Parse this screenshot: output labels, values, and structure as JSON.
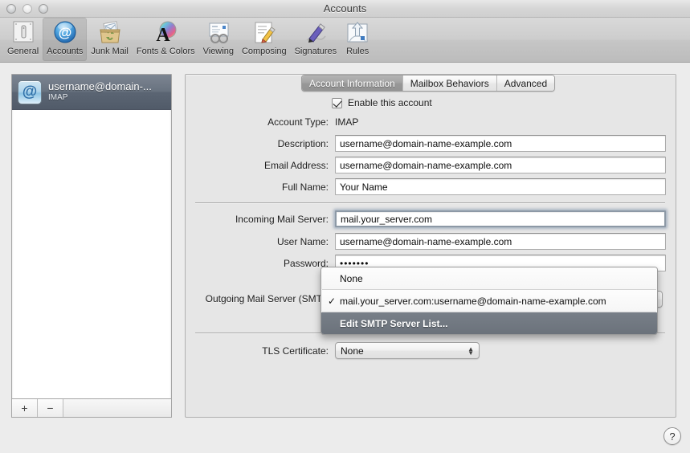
{
  "window": {
    "title": "Accounts",
    "traffic_lights": [
      "close",
      "minimize",
      "zoom"
    ]
  },
  "toolbar": {
    "items": [
      {
        "label": "General",
        "icon": "general-icon",
        "selected": false
      },
      {
        "label": "Accounts",
        "icon": "accounts-at-icon",
        "selected": true
      },
      {
        "label": "Junk Mail",
        "icon": "junk-mail-icon",
        "selected": false
      },
      {
        "label": "Fonts & Colors",
        "icon": "fonts-colors-icon",
        "selected": false
      },
      {
        "label": "Viewing",
        "icon": "viewing-icon",
        "selected": false
      },
      {
        "label": "Composing",
        "icon": "composing-icon",
        "selected": false
      },
      {
        "label": "Signatures",
        "icon": "signatures-icon",
        "selected": false
      },
      {
        "label": "Rules",
        "icon": "rules-icon",
        "selected": false
      }
    ]
  },
  "sidebar": {
    "accounts": [
      {
        "name": "username@domain-...",
        "protocol": "IMAP",
        "icon": "at-account-icon",
        "selected": true
      }
    ],
    "add_label": "+",
    "remove_label": "−"
  },
  "tabs": [
    {
      "label": "Account Information",
      "active": true
    },
    {
      "label": "Mailbox Behaviors",
      "active": false
    },
    {
      "label": "Advanced",
      "active": false
    }
  ],
  "form": {
    "enable_account_label": "Enable this account",
    "enable_account_checked": true,
    "account_type_label": "Account Type:",
    "account_type_value": "IMAP",
    "description_label": "Description:",
    "description_value": "username@domain-name-example.com",
    "email_label": "Email Address:",
    "email_value": "username@domain-name-example.com",
    "full_name_label": "Full Name:",
    "full_name_value": "Your Name",
    "incoming_label": "Incoming Mail Server:",
    "incoming_value": "mail.your_server.com",
    "user_name_label": "User Name:",
    "user_name_value": "username@domain-name-example.com",
    "password_label": "Password:",
    "password_value": "•••••••",
    "smtp_label": "Outgoing Mail Server (SMTP",
    "tls_label": "TLS Certificate:",
    "tls_value": "None",
    "tls_arrows": "▲▼"
  },
  "dropdown": {
    "items": [
      {
        "label": "None",
        "checked": false,
        "highlighted": false
      },
      {
        "label": "mail.your_server.com:username@domain-name-example.com",
        "checked": true,
        "highlighted": false
      },
      {
        "label": "Edit SMTP Server List...",
        "checked": false,
        "highlighted": true
      }
    ],
    "check_glyph": "✓"
  },
  "help": {
    "label": "?"
  },
  "colors": {
    "window_bg": "#ececec",
    "panel_bg": "#e6e6e6",
    "selection_blue_grey": "#68727f",
    "menu_highlight": "#6b727b",
    "focus_ring": "#8d99a6"
  }
}
